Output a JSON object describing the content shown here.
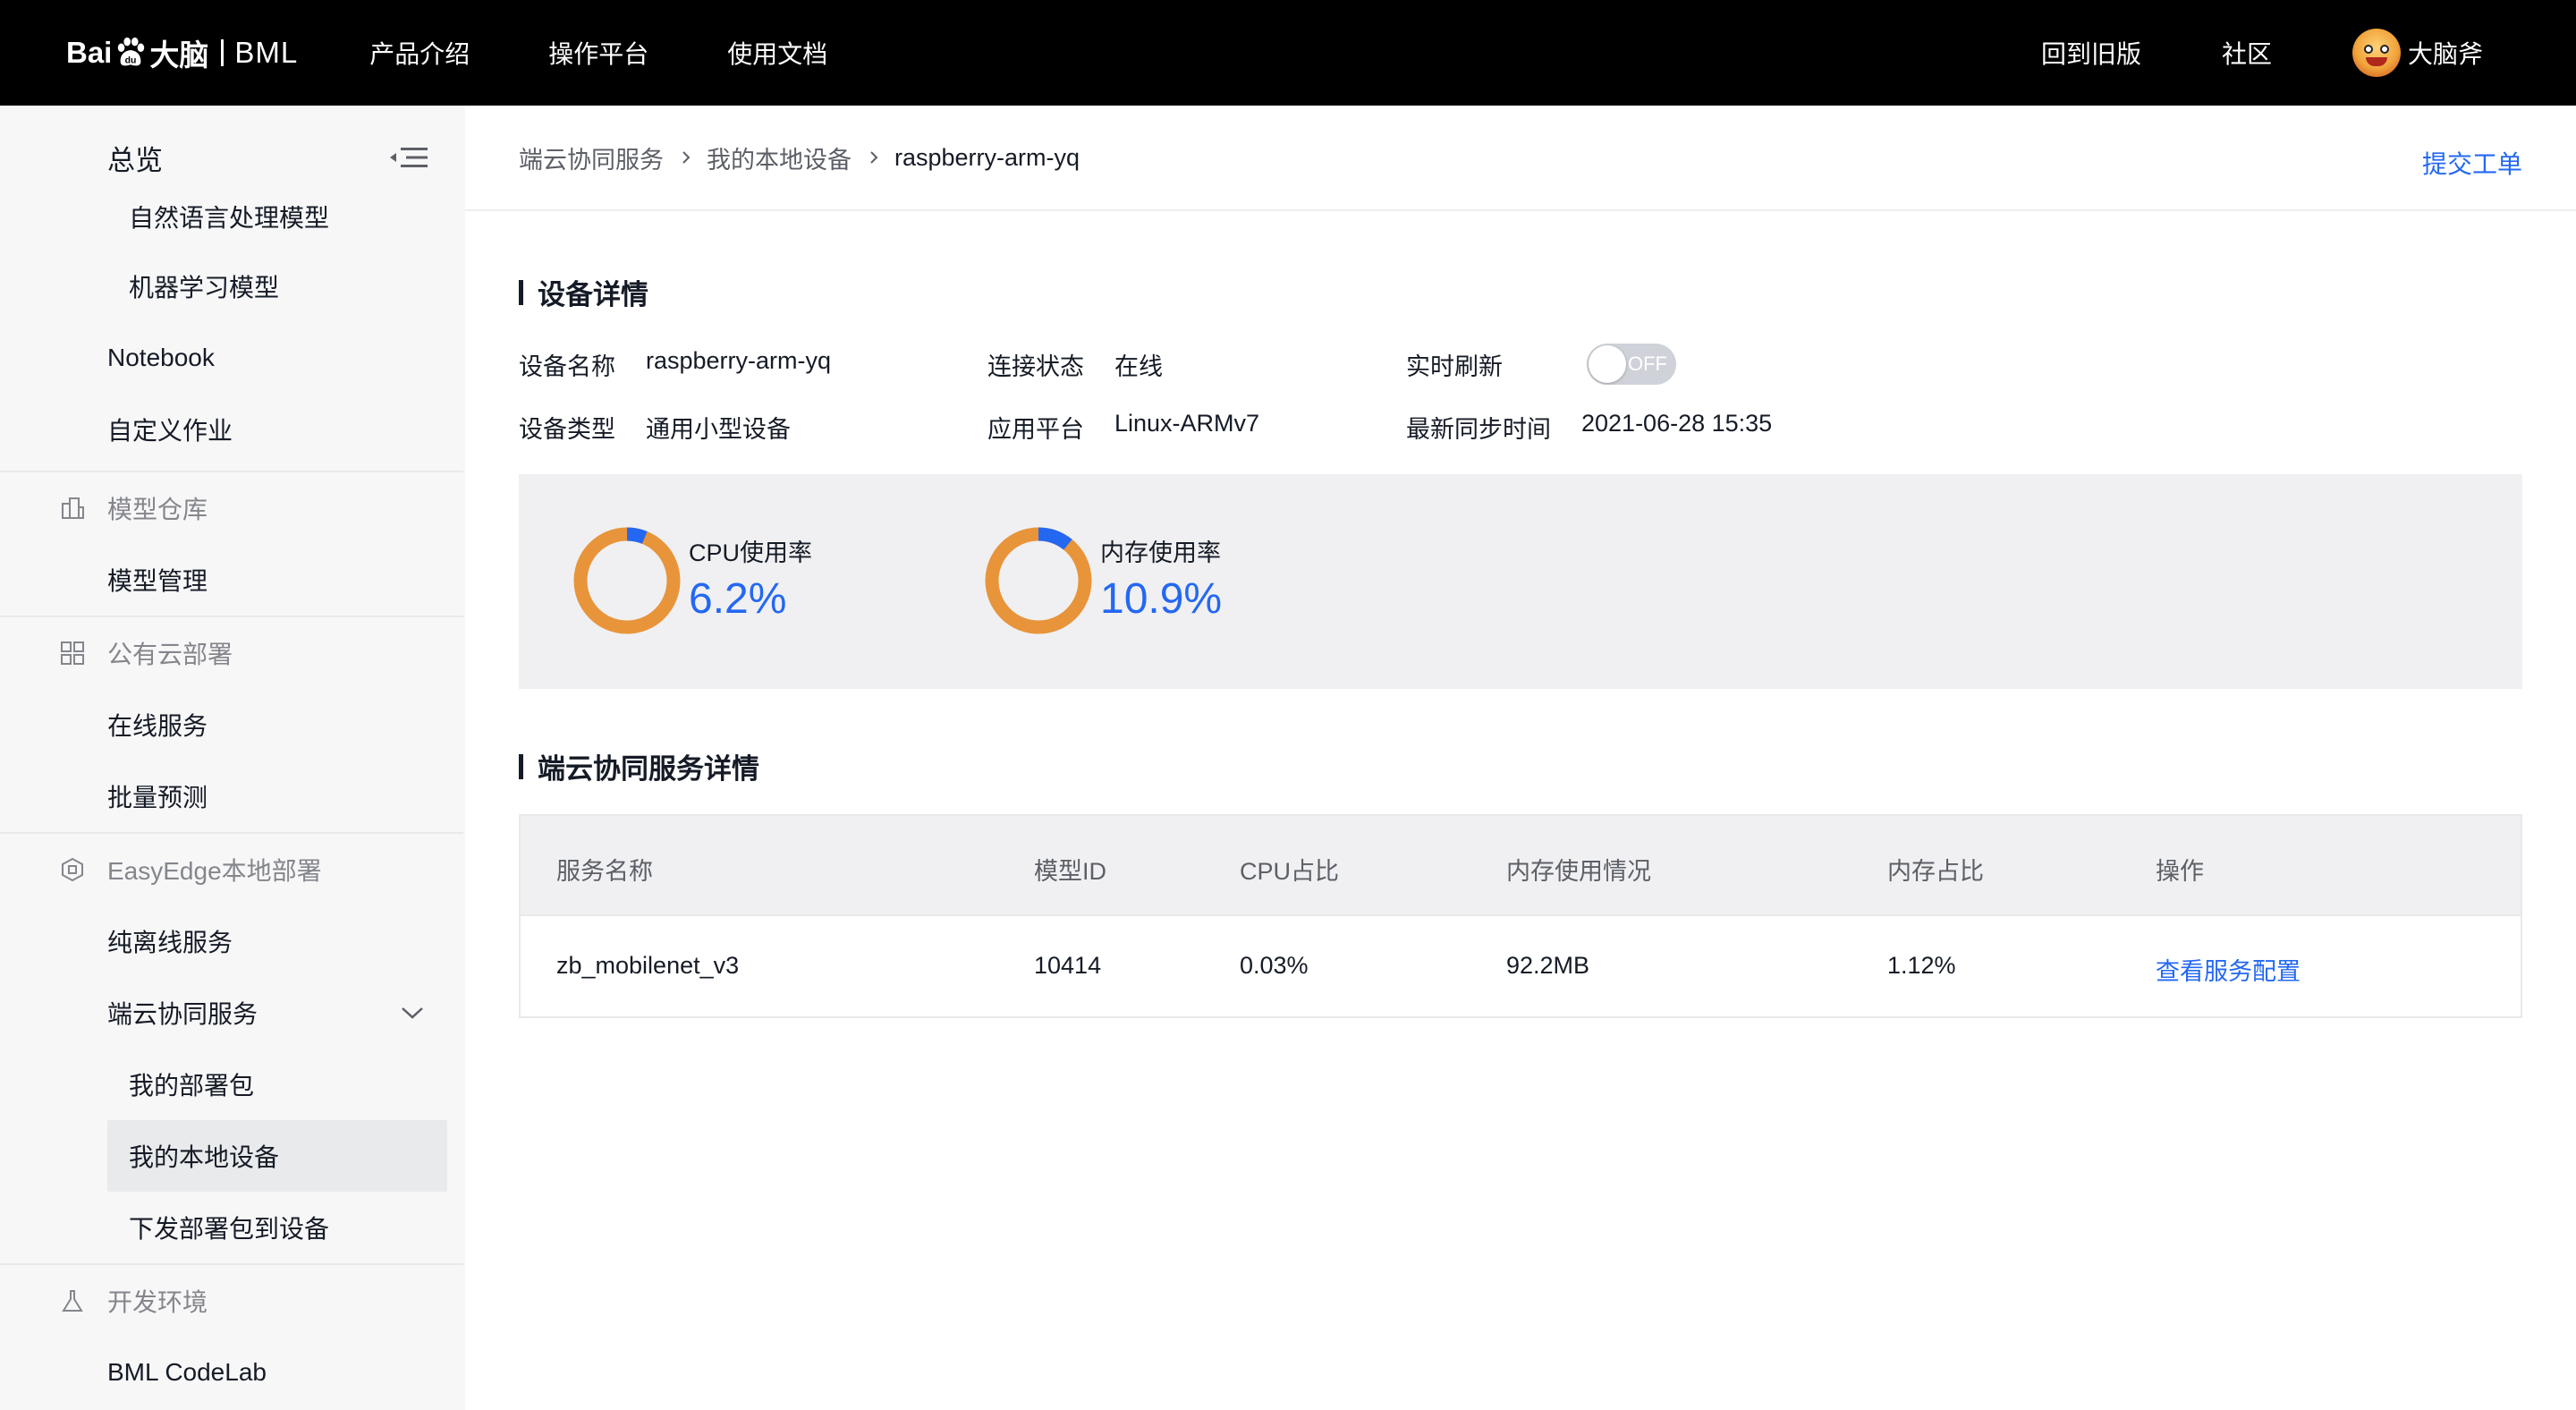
{
  "brand": {
    "logo_text_left": "Bai",
    "logo_text_right": "大脑",
    "product": "BML"
  },
  "topnav": [
    {
      "label": "产品介绍"
    },
    {
      "label": "操作平台"
    },
    {
      "label": "使用文档"
    }
  ],
  "topbar_right": {
    "old_version": "回到旧版",
    "community": "社区",
    "user_name": "大脑斧"
  },
  "sidebar": {
    "overview": "总览",
    "items": {
      "nlp_model": "自然语言处理模型",
      "ml_model": "机器学习模型",
      "notebook": "Notebook",
      "custom_job": "自定义作业",
      "group_model_repo": "模型仓库",
      "model_mgmt": "模型管理",
      "group_public_cloud": "公有云部署",
      "online_service": "在线服务",
      "batch_predict": "批量预测",
      "group_easyedge": "EasyEdge本地部署",
      "offline_service": "纯离线服务",
      "edge_cloud_service": "端云协同服务",
      "my_packages": "我的部署包",
      "my_local_devices": "我的本地设备",
      "deploy_to_device": "下发部署包到设备",
      "group_dev_env": "开发环境",
      "bml_codelab": "BML CodeLab"
    }
  },
  "breadcrumb": [
    "端云协同服务",
    "我的本地设备",
    "raspberry-arm-yq"
  ],
  "ticket_link": "提交工单",
  "device_detail": {
    "title": "设备详情",
    "name_label": "设备名称",
    "name_value": "raspberry-arm-yq",
    "conn_label": "连接状态",
    "conn_value": "在线",
    "refresh_label": "实时刷新",
    "refresh_toggle": "OFF",
    "type_label": "设备类型",
    "type_value": "通用小型设备",
    "platform_label": "应用平台",
    "platform_value": "Linux-ARMv7",
    "sync_label": "最新同步时间",
    "sync_value": "2021-06-28 15:35"
  },
  "usage": {
    "cpu": {
      "label": "CPU使用率",
      "value": "6.2%",
      "fraction": 0.062
    },
    "memory": {
      "label": "内存使用率",
      "value": "10.9%",
      "fraction": 0.109
    },
    "colors": {
      "used": "#2468f2",
      "free": "#e8943a"
    }
  },
  "service_detail": {
    "title": "端云协同服务详情",
    "columns": [
      "服务名称",
      "模型ID",
      "CPU占比",
      "内存使用情况",
      "内存占比",
      "操作"
    ],
    "rows": [
      {
        "name": "zb_mobilenet_v3",
        "model_id": "10414",
        "cpu": "0.03%",
        "mem": "92.2MB",
        "mem_ratio": "1.12%",
        "action": "查看服务配置"
      }
    ]
  },
  "colors": {
    "accent": "#2468f2",
    "topbar": "#000000"
  }
}
